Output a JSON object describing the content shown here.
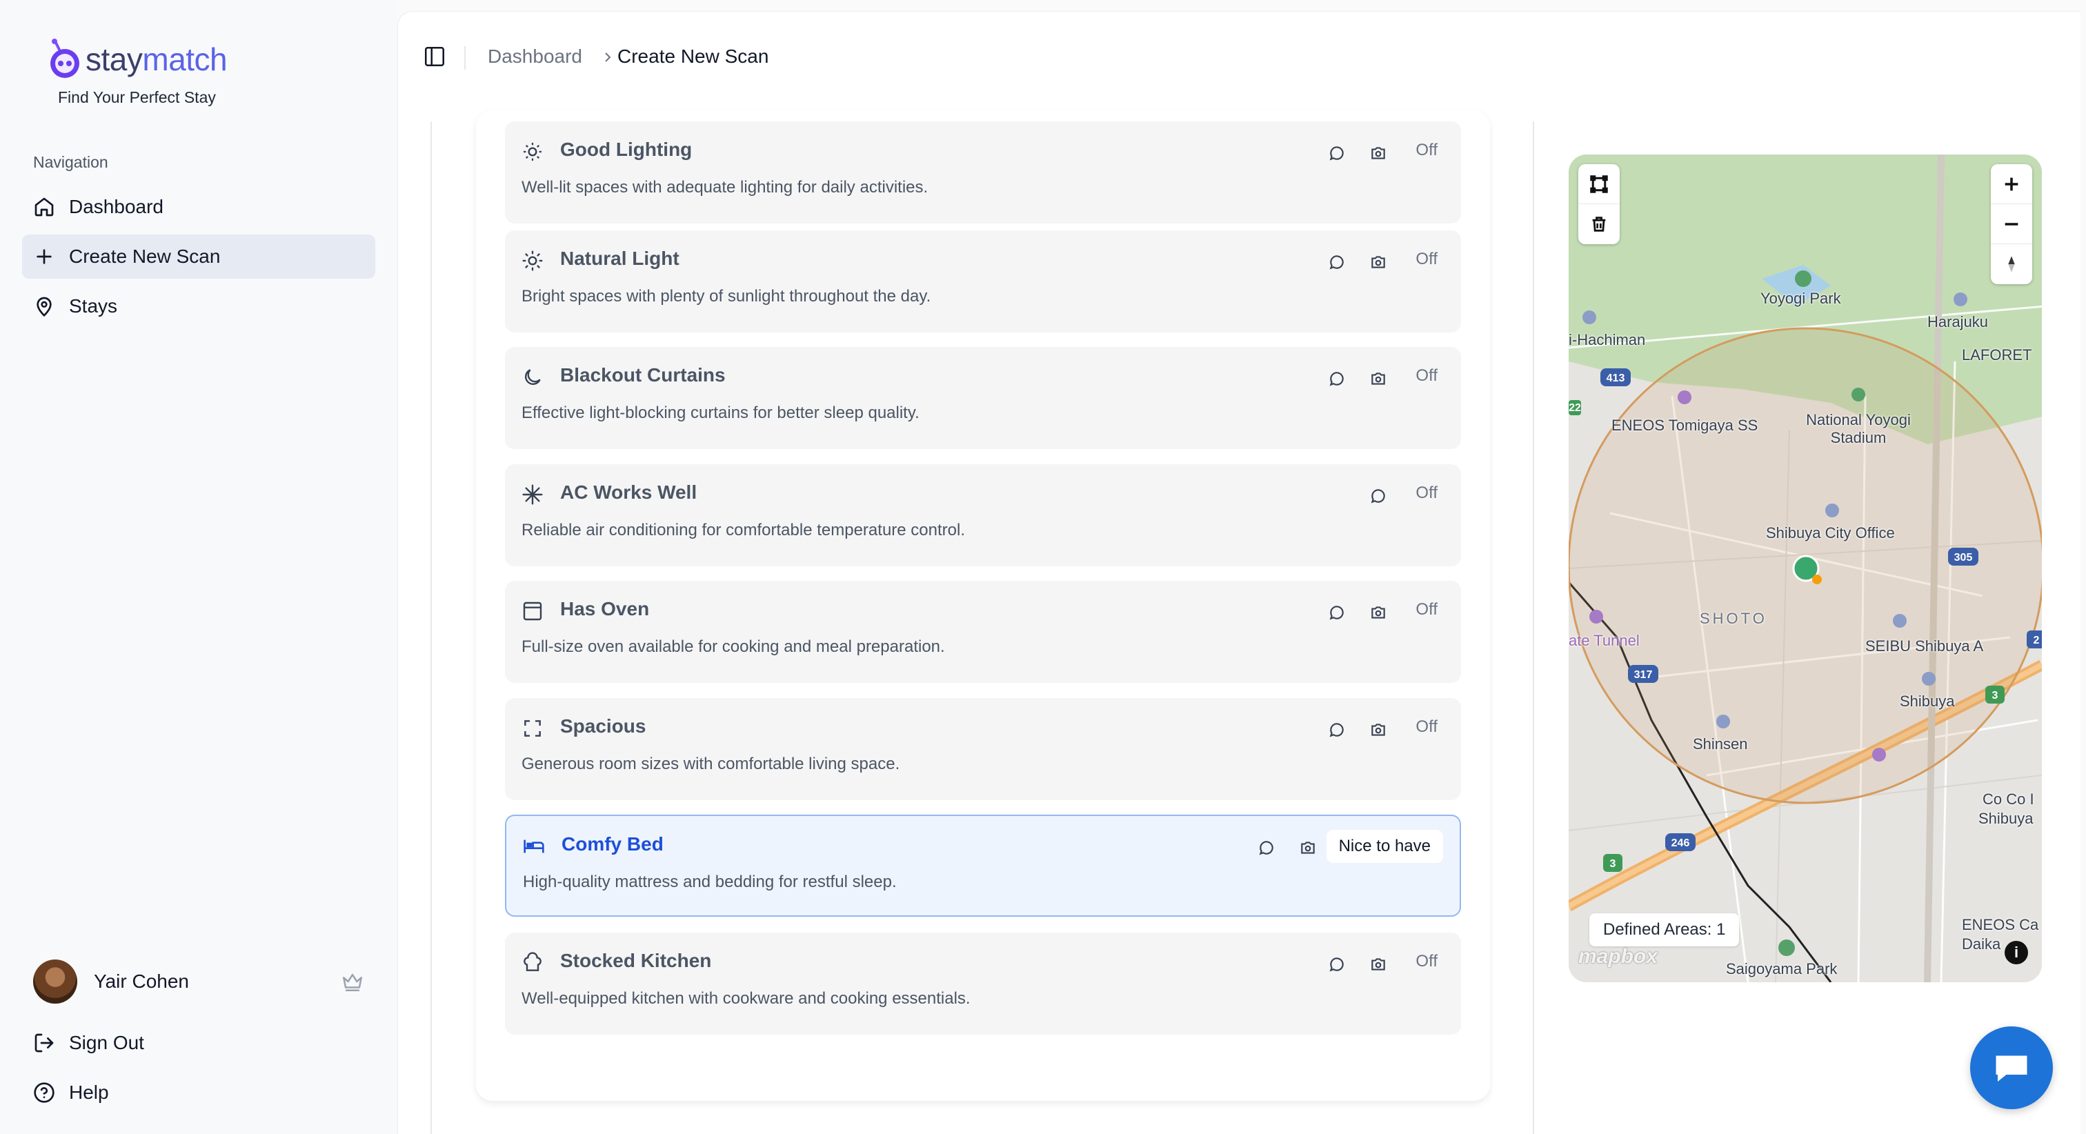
{
  "brand": {
    "name_part1": "stay",
    "name_part2": "match",
    "tagline": "Find Your Perfect Stay",
    "logo_icon": "robot-icon"
  },
  "sidebar": {
    "heading": "Navigation",
    "items": [
      {
        "label": "Dashboard",
        "icon": "home-icon",
        "active": false
      },
      {
        "label": "Create New Scan",
        "icon": "plus-icon",
        "active": true
      },
      {
        "label": "Stays",
        "icon": "map-pin-icon",
        "active": false
      }
    ],
    "user": {
      "name": "Yair Cohen",
      "badge_icon": "crown-icon"
    },
    "sign_out": "Sign Out",
    "help": "Help"
  },
  "breadcrumb": {
    "parent": "Dashboard",
    "current": "Create New Scan"
  },
  "features": [
    {
      "title": "Good Lighting",
      "desc": "Well-lit spaces with adequate lighting for daily activities.",
      "status": "Off",
      "icon": "sun-dim-icon",
      "has_camera": true,
      "selected": false
    },
    {
      "title": "Natural Light",
      "desc": "Bright spaces with plenty of sunlight throughout the day.",
      "status": "Off",
      "icon": "sun-icon",
      "has_camera": true,
      "selected": false
    },
    {
      "title": "Blackout Curtains",
      "desc": "Effective light-blocking curtains for better sleep quality.",
      "status": "Off",
      "icon": "moon-icon",
      "has_camera": true,
      "selected": false
    },
    {
      "title": "AC Works Well",
      "desc": "Reliable air conditioning for comfortable temperature control.",
      "status": "Off",
      "icon": "snowflake-icon",
      "has_camera": false,
      "selected": false
    },
    {
      "title": "Has Oven",
      "desc": "Full-size oven available for cooking and meal preparation.",
      "status": "Off",
      "icon": "oven-icon",
      "has_camera": true,
      "selected": false
    },
    {
      "title": "Spacious",
      "desc": "Generous room sizes with comfortable living space.",
      "status": "Off",
      "icon": "expand-icon",
      "has_camera": true,
      "selected": false
    },
    {
      "title": "Comfy Bed",
      "desc": "High-quality mattress and bedding for restful sleep.",
      "status": "Nice to have",
      "icon": "bed-icon",
      "has_camera": true,
      "selected": true
    },
    {
      "title": "Stocked Kitchen",
      "desc": "Well-equipped kitchen with cookware and cooking essentials.",
      "status": "Off",
      "icon": "chef-hat-icon",
      "has_camera": true,
      "selected": false
    }
  ],
  "map": {
    "labels": {
      "yoyogi_park": "Yoyogi Park",
      "harajuku": "Harajuku",
      "hachiman": "i-Hachiman",
      "laforet": "LAFORET",
      "eneos_tomigaya": "ENEOS Tomigaya SS",
      "national_stadium": "National Yoyogi Stadium",
      "shibuya_city_office": "Shibuya City Office",
      "shoto": "SHOTO",
      "tunnel": "ate Tunnel",
      "seibu": "SEIBU Shibuya A",
      "shibuya": "Shibuya",
      "shinsen": "Shinsen",
      "coco": "Co Co I",
      "coco_sub": "Shibuya",
      "eneos_daika": "ENEOS Ca",
      "daika_sub": "Daika",
      "saigoyama": "Saigoyama Park"
    },
    "route_numbers": [
      "413",
      "305",
      "317",
      "246",
      "3",
      "3",
      "2",
      "2",
      "22"
    ],
    "defined_areas": "Defined Areas: 1",
    "attribution": "mapbox",
    "info": "i"
  },
  "chat": {
    "icon": "chat-bubble-icon"
  }
}
